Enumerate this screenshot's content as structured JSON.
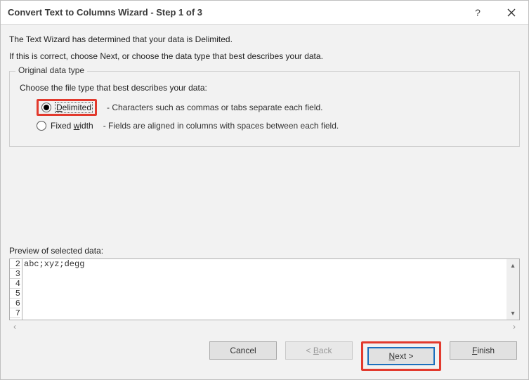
{
  "title": "Convert Text to Columns Wizard - Step 1 of 3",
  "intro1": "The Text Wizard has determined that your data is Delimited.",
  "intro2": "If this is correct, choose Next, or choose the data type that best describes your data.",
  "group": {
    "legend": "Original data type",
    "prompt": "Choose the file type that best describes your data:",
    "delimited": {
      "label": "Delimited",
      "desc": "- Characters such as commas or tabs separate each field."
    },
    "fixed": {
      "label": "Fixed width",
      "desc": "- Fields are aligned in columns with spaces between each field."
    }
  },
  "preview": {
    "label": "Preview of selected data:",
    "rows": [
      "2",
      "3",
      "4",
      "5",
      "6",
      "7"
    ],
    "data": [
      "abc;xyz;degg",
      "",
      "",
      "",
      "",
      ""
    ]
  },
  "buttons": {
    "cancel": "Cancel",
    "back": "< Back",
    "next": "Next >",
    "finish": "Finish"
  }
}
